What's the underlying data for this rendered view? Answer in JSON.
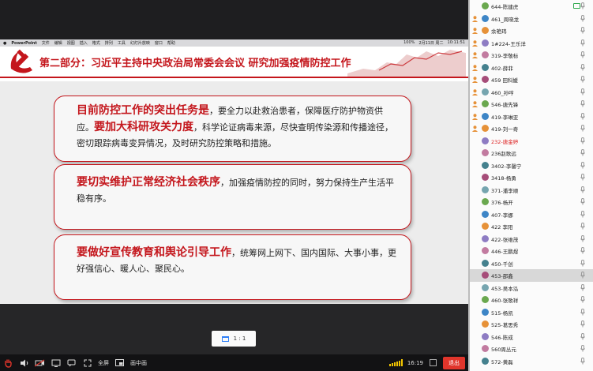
{
  "menubar": {
    "items": [
      "PowerPoint",
      "文件",
      "编辑",
      "视图",
      "插入",
      "格式",
      "排列",
      "工具",
      "幻灯片放映",
      "窗口",
      "帮助"
    ],
    "right": [
      "100%",
      "2月11日 周二",
      "10:11:51"
    ]
  },
  "slide": {
    "title": "第二部分：习近平主持中央政治局常委会会议 研究加强疫情防控工作",
    "card1": {
      "hl1": "目前防控工作的突出任务是",
      "t1": "，要全力以赴救治患者，保障医疗防护物资供应。",
      "hl2": "要加大科研攻关力度",
      "t2": "，科学论证病毒来源，尽快查明传染源和传播途径，密切跟踪病毒变异情况，及时研究防控策略和措施。"
    },
    "card2": {
      "hl1": "要切实维护正常经济社会秩序",
      "t1": "，加强疫情防控的同时，努力保持生产生活平稳有序。"
    },
    "card3": {
      "hl1": "要做好宣传教育和舆论引导工作",
      "t1": "，统筹网上网下、国内国际、大事小事，更好强信心、暖人心、聚民心。"
    }
  },
  "view": {
    "ratio": "1 : 1"
  },
  "bottombar": {
    "fullscreen": "全屏",
    "pip": "画中画",
    "time": "16:19",
    "exit": "退出"
  },
  "colors": {
    "accent_red": "#c4161c",
    "exit_red": "#e0352b",
    "signal": "#f2c400"
  },
  "participants": [
    {
      "name": "644-陈建虎",
      "pinned": false,
      "cam": true,
      "red": false
    },
    {
      "name": "461_周晓龙",
      "pinned": true,
      "cam": false,
      "red": false
    },
    {
      "name": "余艳玮",
      "pinned": true,
      "cam": false,
      "red": false
    },
    {
      "name": "1#224-王乐洋",
      "pinned": true,
      "cam": false,
      "red": false
    },
    {
      "name": "319-李敬标",
      "pinned": true,
      "cam": false,
      "red": false
    },
    {
      "name": "402-薛菲",
      "pinned": true,
      "cam": false,
      "red": false
    },
    {
      "name": "459 田科媛",
      "pinned": true,
      "cam": false,
      "red": false
    },
    {
      "name": "460_孙哼",
      "pinned": true,
      "cam": false,
      "red": false
    },
    {
      "name": "546-唐先锋",
      "pinned": true,
      "cam": false,
      "red": false
    },
    {
      "name": "419-李琳亚",
      "pinned": true,
      "cam": false,
      "red": false
    },
    {
      "name": "419-刘一奇",
      "pinned": true,
      "cam": false,
      "red": false
    },
    {
      "name": "232-唐金婷",
      "pinned": false,
      "cam": false,
      "red": true
    },
    {
      "name": "236赵歌远",
      "pinned": false,
      "cam": false,
      "red": false
    },
    {
      "name": "3402-李馨宁",
      "pinned": false,
      "cam": false,
      "red": false
    },
    {
      "name": "3418-杨勇",
      "pinned": false,
      "cam": false,
      "red": false
    },
    {
      "name": "371-潘李顺",
      "pinned": false,
      "cam": false,
      "red": false
    },
    {
      "name": "376-杨开",
      "pinned": false,
      "cam": false,
      "red": false
    },
    {
      "name": "407-李娜",
      "pinned": false,
      "cam": false,
      "red": false
    },
    {
      "name": "422 李阳",
      "pinned": false,
      "cam": false,
      "red": false
    },
    {
      "name": "422-张维茂",
      "pinned": false,
      "cam": false,
      "red": false
    },
    {
      "name": "446-王鹏煜",
      "pinned": false,
      "cam": false,
      "red": false
    },
    {
      "name": "450-千创",
      "pinned": false,
      "cam": false,
      "red": false
    },
    {
      "name": "453-邵鑫",
      "pinned": false,
      "cam": false,
      "red": false
    },
    {
      "name": "453-吴本泓",
      "pinned": false,
      "cam": false,
      "red": false
    },
    {
      "name": "460-张歌祥",
      "pinned": false,
      "cam": false,
      "red": false
    },
    {
      "name": "515-杨凯",
      "pinned": false,
      "cam": false,
      "red": false
    },
    {
      "name": "525-葛思秀",
      "pinned": false,
      "cam": false,
      "red": false
    },
    {
      "name": "546-陈成",
      "pinned": false,
      "cam": false,
      "red": false
    },
    {
      "name": "560周丛元",
      "pinned": false,
      "cam": false,
      "red": false
    },
    {
      "name": "572-黄磊",
      "pinned": false,
      "cam": false,
      "red": false
    }
  ]
}
